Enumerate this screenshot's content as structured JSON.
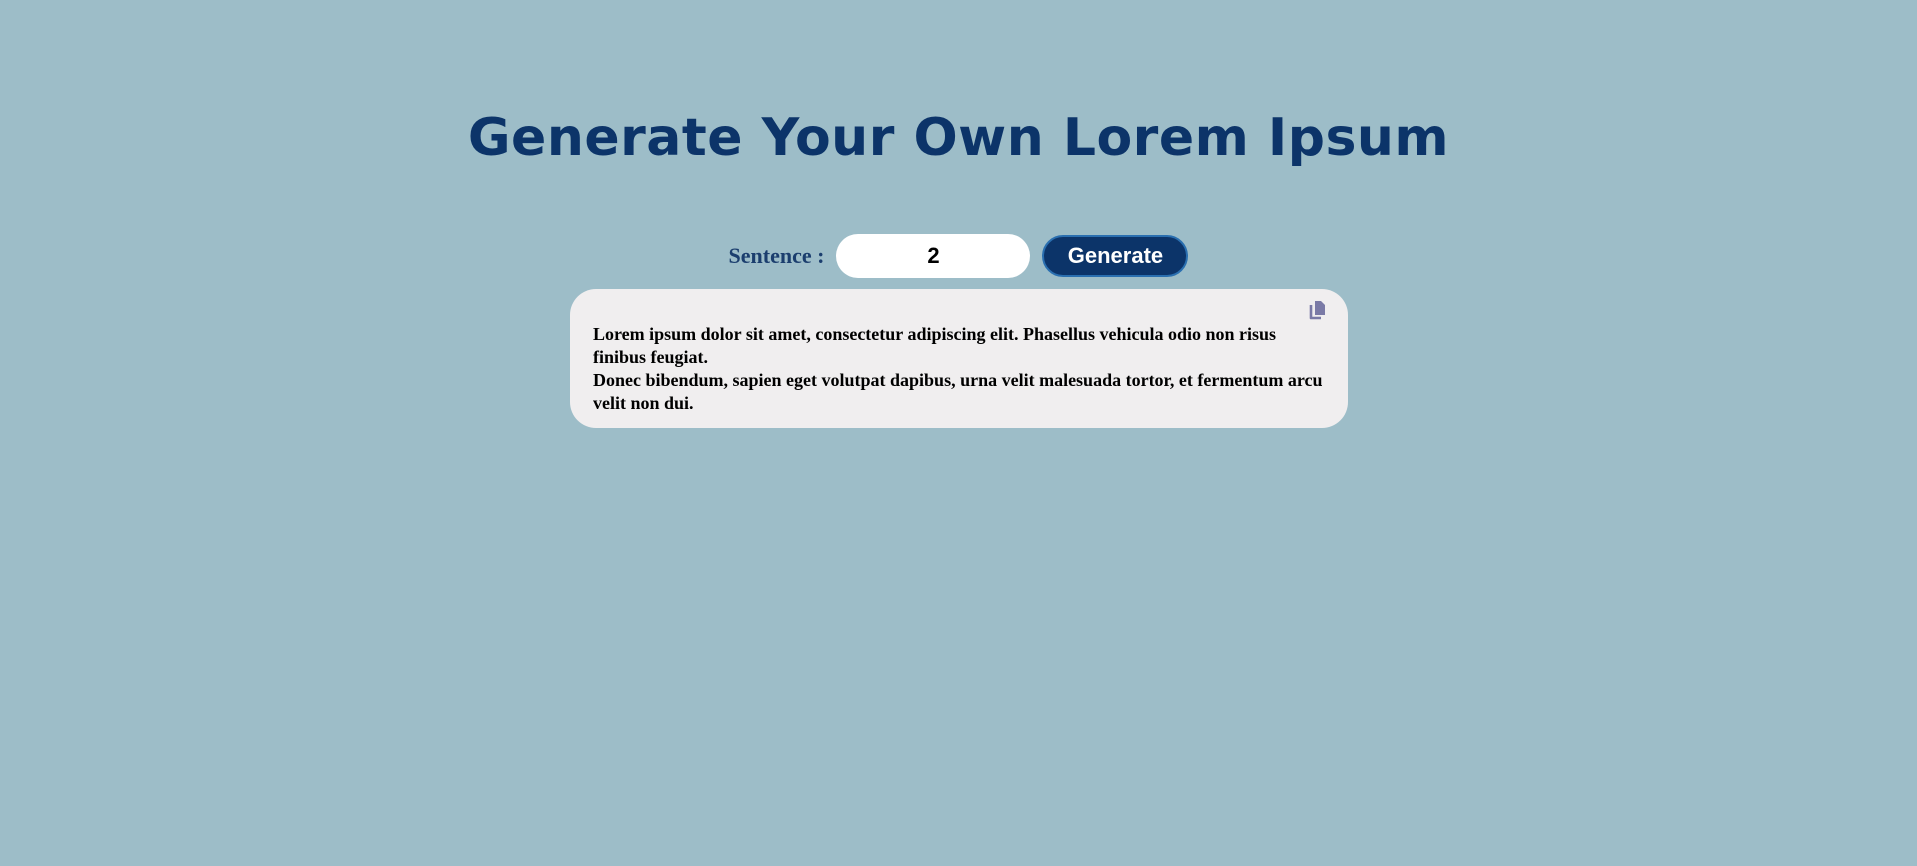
{
  "title": "Generate Your Own Lorem Ipsum",
  "controls": {
    "sentence_label": "Sentence :",
    "sentence_count": "2",
    "generate_label": "Generate"
  },
  "output": {
    "copy_icon": "copy-icon",
    "paragraphs": [
      "Lorem ipsum dolor sit amet, consectetur adipiscing elit. Phasellus vehicula odio non risus finibus feugiat.",
      "Donec bibendum, sapien eget volutpat dapibus, urna velit malesuada tortor, et fermentum arcu velit non dui."
    ]
  },
  "colors": {
    "background": "#9dbdc8",
    "title": "#0c3469",
    "button": "#0c3469",
    "output_background": "#f0eeef",
    "copy_icon": "#7a7aa6"
  }
}
